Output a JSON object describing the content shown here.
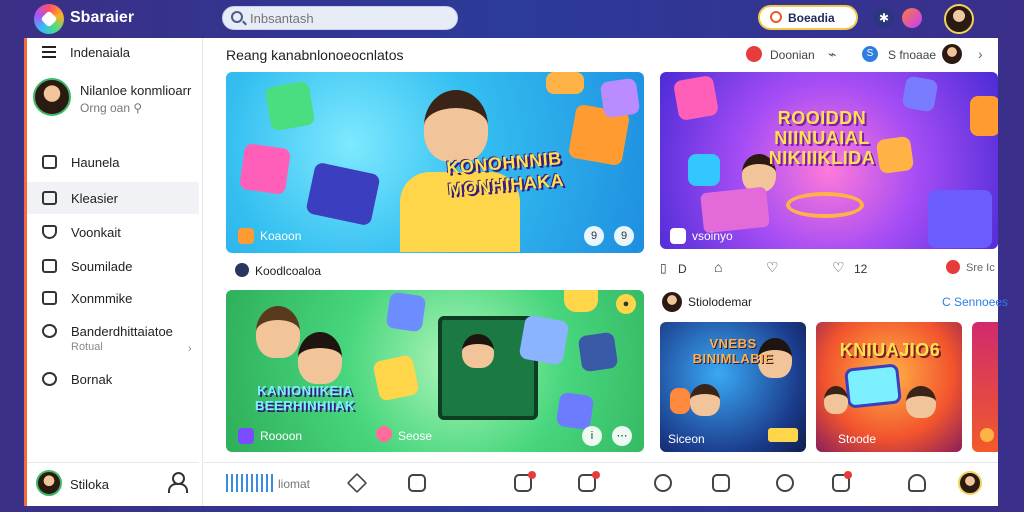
{
  "app": {
    "title": "Sbaraier"
  },
  "search": {
    "placeholder": "Inbsantash",
    "value": ""
  },
  "top": {
    "cta_label": "Boeadia"
  },
  "sidebar": {
    "menu_title": "Indenaiala",
    "profile": {
      "name": "Nilanloe konmlioarr",
      "sub": "Orng oan"
    },
    "items": [
      {
        "label": "Haunela"
      },
      {
        "label": "Kleasier"
      },
      {
        "label": "Voonkait"
      },
      {
        "label": "Soumilade"
      },
      {
        "label": "Xonmmike"
      },
      {
        "label": "Banderdhittaiatoe",
        "sub": "Rotual"
      },
      {
        "label": "Bornak"
      }
    ],
    "footer": {
      "name": "Stiloka"
    }
  },
  "main": {
    "section_title": "Reang kanabnlonoeocnlatos",
    "header": {
      "alert_label": "Doonian",
      "s_label": "S fnoaae"
    },
    "card1": {
      "title": "KONOHNNIB MONHIHAKA",
      "tag": "Koaoon",
      "btn1": "9",
      "btn2": "9"
    },
    "card2": {
      "title": "ROOIDDN NIINUAIAL NIKIIIKLIDA",
      "tag": "vsoinyo"
    },
    "channel_row": {
      "label": "Koodlcoaloa"
    },
    "stats": {
      "s1": "D",
      "s3": "12",
      "s4": "Sre Ic"
    },
    "card3": {
      "title": "KANIONIIKEIA BEERHINHIIAK",
      "tag1": "Roooon",
      "tag2": "Seose"
    },
    "side": {
      "title": "Stiolodemar",
      "link": "C Sennoees"
    },
    "tile1": {
      "title": "VNEBS BINIMLABIE",
      "label": "Siceon"
    },
    "tile2": {
      "title": "KNIUAJIO6",
      "label": "Stoode"
    }
  },
  "bottom_bar": {
    "label": "liomat"
  },
  "colors": {
    "accent": "#2f7de1",
    "brand": "#3b2f86",
    "alert": "#e83b3b",
    "sidebar_edge": "#f26b3a"
  }
}
